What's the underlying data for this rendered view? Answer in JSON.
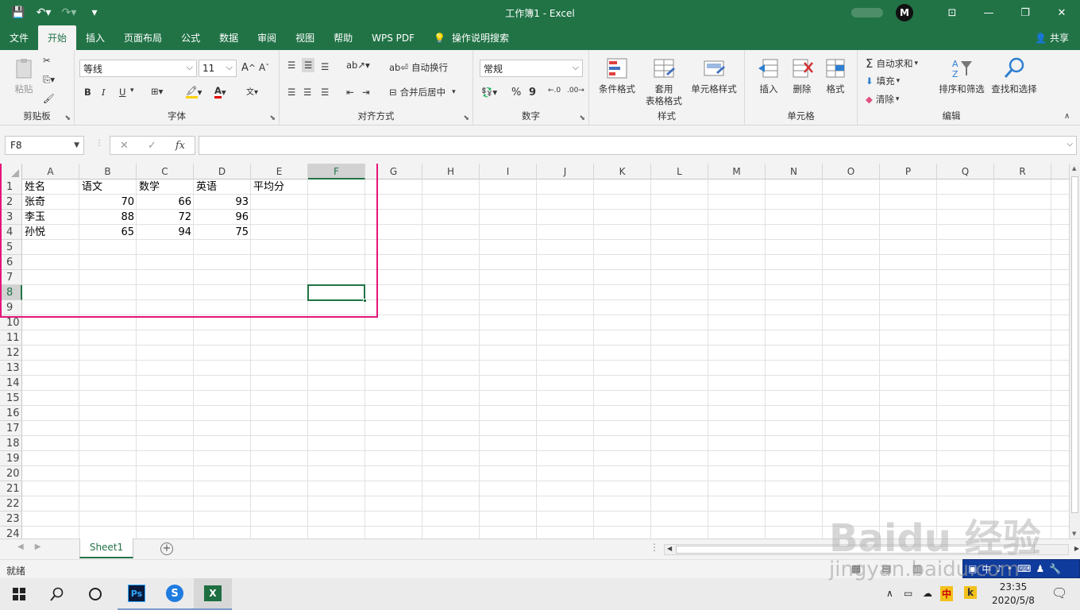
{
  "titlebar": {
    "title": "工作簿1 - Excel",
    "avatar_initial": "M"
  },
  "menu": {
    "tabs": [
      "文件",
      "开始",
      "插入",
      "页面布局",
      "公式",
      "数据",
      "审阅",
      "视图",
      "帮助",
      "WPS PDF",
      "操作说明搜索"
    ],
    "active": "开始",
    "share": "共享"
  },
  "ribbon": {
    "clipboard": {
      "paste": "粘贴",
      "label": "剪贴板"
    },
    "font": {
      "name": "等线",
      "size": "11",
      "bold": "B",
      "italic": "I",
      "underline": "U",
      "label": "字体"
    },
    "alignment": {
      "wrap": "自动换行",
      "merge": "合并后居中",
      "label": "对齐方式"
    },
    "number": {
      "format": "常规",
      "percent": "%",
      "comma": "9",
      "label": "数字"
    },
    "styles": {
      "conditional": "条件格式",
      "table_format_1": "套用",
      "table_format_2": "表格格式",
      "cell_styles": "单元格样式",
      "label": "样式"
    },
    "cells": {
      "insert": "插入",
      "delete": "删除",
      "format": "格式",
      "label": "单元格"
    },
    "editing": {
      "autosum": "自动求和",
      "fill": "填充",
      "clear": "清除",
      "sort": "排序和筛选",
      "find": "查找和选择",
      "label": "编辑"
    }
  },
  "formula": {
    "namebox": "F8",
    "fx": "fx",
    "content": ""
  },
  "sheet": {
    "columns": [
      "A",
      "B",
      "C",
      "D",
      "E",
      "F",
      "G",
      "H",
      "I",
      "J",
      "K",
      "L",
      "M",
      "N",
      "O",
      "P",
      "Q",
      "R"
    ],
    "rows": [
      "1",
      "2",
      "3",
      "4",
      "5",
      "6",
      "7",
      "8",
      "9",
      "10",
      "11",
      "12",
      "13",
      "14",
      "15",
      "16",
      "17",
      "18",
      "19",
      "20",
      "21",
      "22",
      "23",
      "24"
    ],
    "cells": [
      [
        "姓名",
        "语文",
        "数学",
        "英语",
        "平均分"
      ],
      [
        "张奇",
        "70",
        "66",
        "93",
        ""
      ],
      [
        "李玉",
        "88",
        "72",
        "96",
        ""
      ],
      [
        "孙悦",
        "65",
        "94",
        "75",
        ""
      ]
    ],
    "selected_cell": "F8",
    "selected_column": "F",
    "selected_row": "8"
  },
  "tabs": {
    "sheet_name": "Sheet1"
  },
  "status": {
    "ready": "就绪"
  },
  "taskbar": {
    "ime_lang": "中",
    "time": "23:35",
    "date": "2020/5/8"
  },
  "watermark": {
    "brand": "Baidu 经验",
    "url": "jingyan.baidu.com"
  },
  "colors": {
    "excel_green": "#217346",
    "highlight_pink": "#e5157a"
  }
}
